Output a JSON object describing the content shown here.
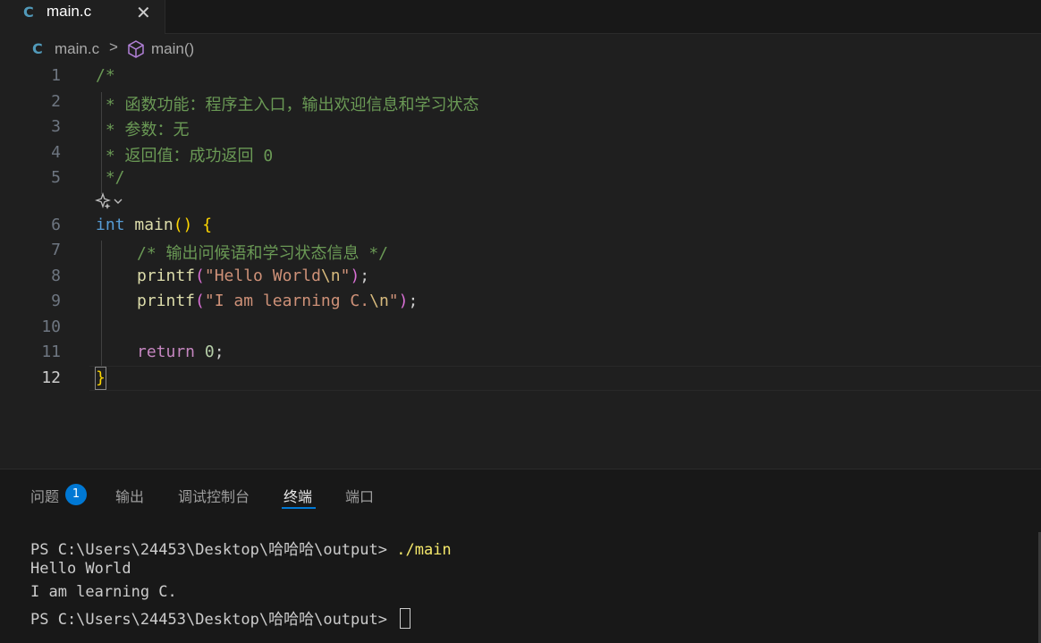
{
  "tab": {
    "icon": "c-language-icon",
    "title": "main.c",
    "close_glyph": "✕"
  },
  "breadcrumb": {
    "file": "main.c",
    "separator": ">",
    "symbol": "main()"
  },
  "editor": {
    "line_numbers": [
      "1",
      "2",
      "3",
      "4",
      "5",
      "6",
      "7",
      "8",
      "9",
      "10",
      "11",
      "12"
    ],
    "active_line": "12",
    "lines": {
      "l1": "/*",
      "l2": " * 函数功能：程序主入口，输出欢迎信息和学习状态",
      "l3": " * 参数：无",
      "l4": " * 返回值：成功返回 0",
      "l5": " */",
      "l6_kw": "int",
      "l6_fn": "main",
      "l6_paren": "()",
      "l6_brace": "{",
      "l7": "/* 输出问候语和学习状态信息 */",
      "l8_fn": "printf",
      "l8_open": "(",
      "l8_str": "\"Hello World",
      "l8_esc": "\\n",
      "l8_strend": "\"",
      "l8_close": ")",
      "l8_semi": ";",
      "l9_fn": "printf",
      "l9_open": "(",
      "l9_str": "\"I am learning C.",
      "l9_esc": "\\n",
      "l9_strend": "\"",
      "l9_close": ")",
      "l9_semi": ";",
      "l11_kw": "return",
      "l11_num": "0",
      "l11_semi": ";",
      "l12": "}"
    }
  },
  "panel": {
    "tabs": [
      {
        "label": "问题",
        "badge": "1"
      },
      {
        "label": "输出"
      },
      {
        "label": "调试控制台"
      },
      {
        "label": "终端",
        "active": true
      },
      {
        "label": "端口"
      }
    ],
    "terminal": {
      "prompt": "PS C:\\Users\\24453\\Desktop\\哈哈哈\\output> ",
      "command": "./main",
      "output": [
        "Hello World",
        "I am learning C."
      ],
      "prompt2": "PS C:\\Users\\24453\\Desktop\\哈哈哈\\output> "
    }
  },
  "colors": {
    "background": "#1f1f1f",
    "accent": "#0078d4",
    "comment": "#6a9955",
    "keyword": "#569cd6",
    "function": "#dcdcaa",
    "string": "#ce9178"
  }
}
